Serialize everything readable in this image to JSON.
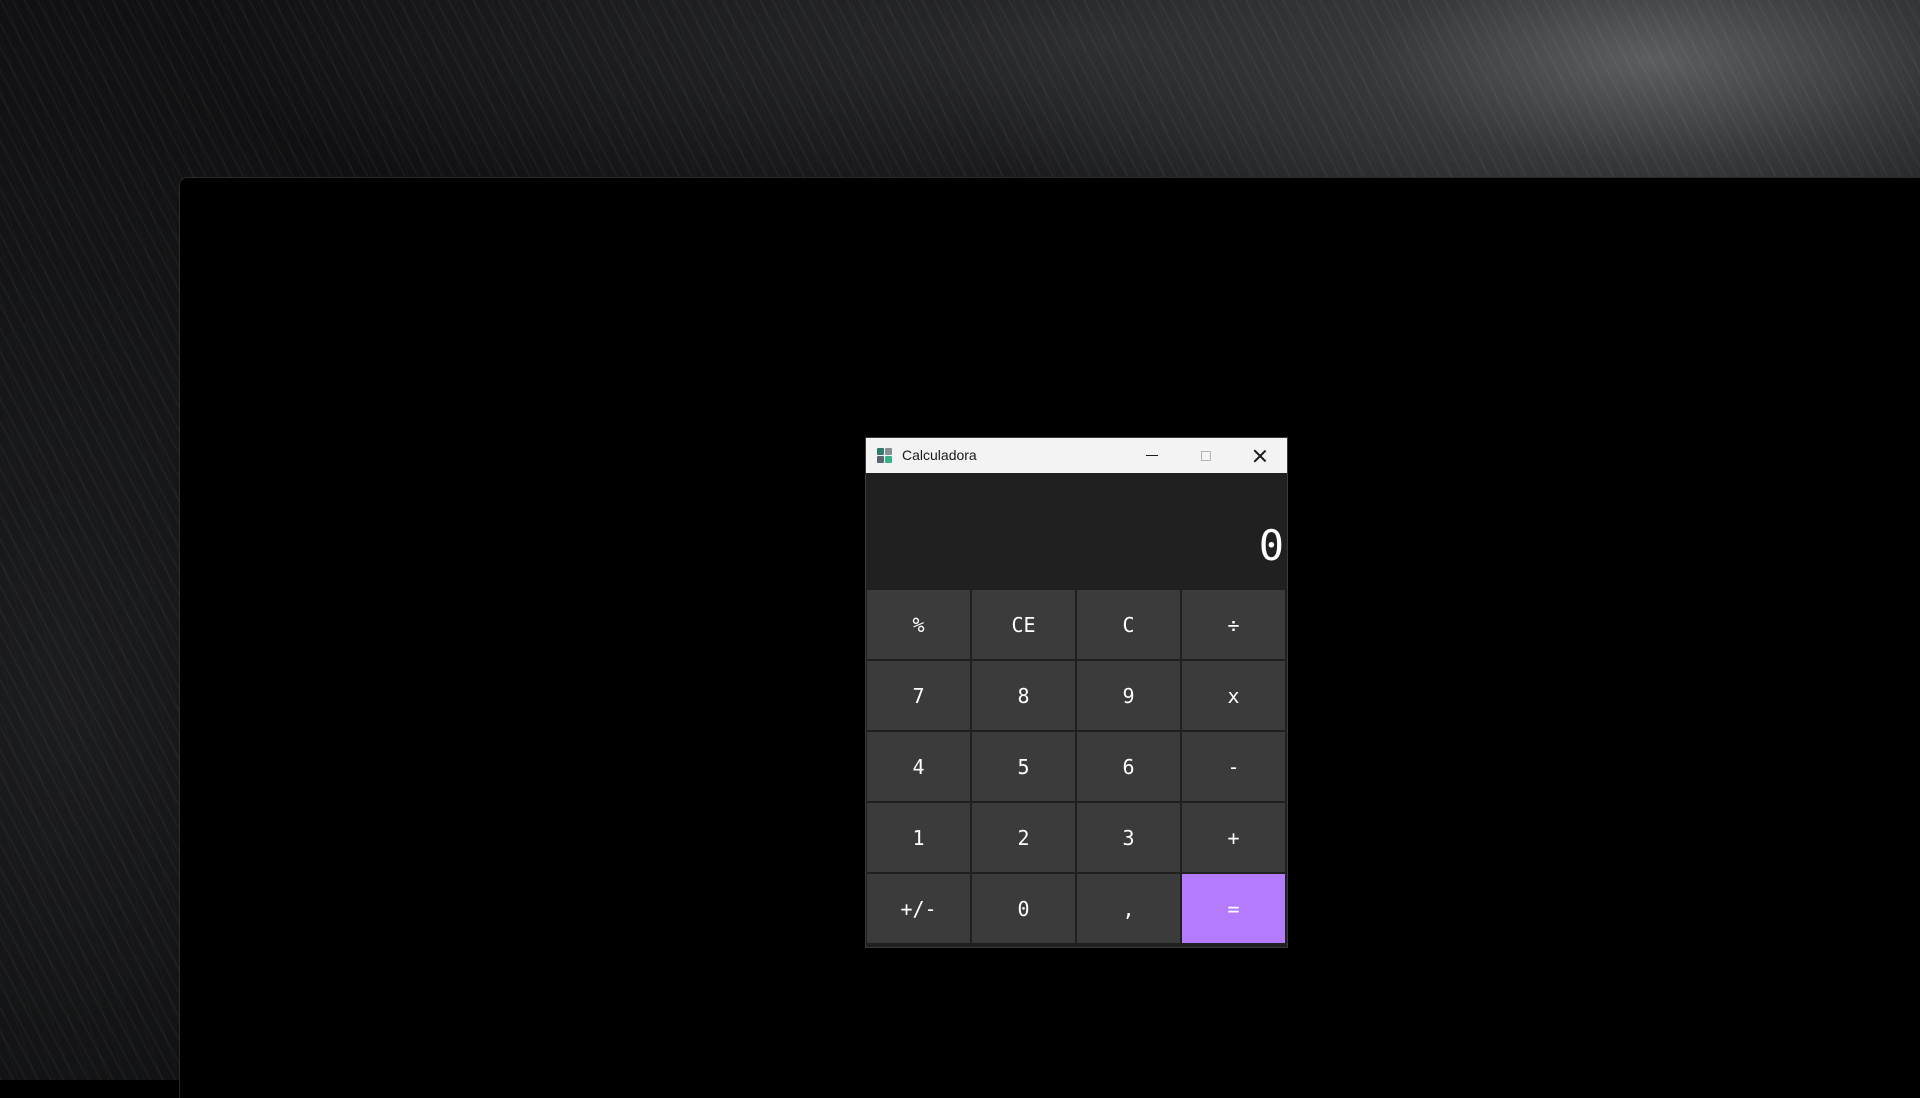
{
  "window": {
    "title": "Calculadora"
  },
  "display": {
    "value": "0"
  },
  "keypad": {
    "rows": [
      [
        "%",
        "CE",
        "C",
        "÷"
      ],
      [
        "7",
        "8",
        "9",
        "x"
      ],
      [
        "4",
        "5",
        "6",
        "-"
      ],
      [
        "1",
        "2",
        "3",
        "+"
      ],
      [
        "+/-",
        "0",
        ",",
        "="
      ]
    ]
  },
  "colors": {
    "accent": "#b57bff",
    "key_background": "#3b3b3b",
    "display_background": "#202020",
    "titlebar_background": "#f3f3f3"
  },
  "icons": {
    "app": "calculator-icon",
    "minimize": "minimize-icon",
    "maximize": "maximize-icon",
    "close": "close-icon"
  }
}
